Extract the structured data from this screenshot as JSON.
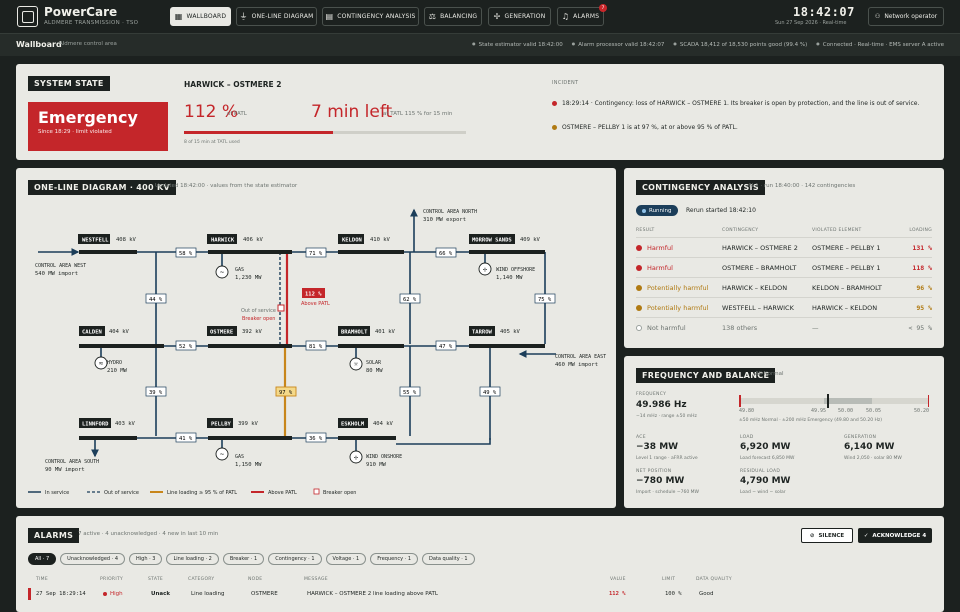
{
  "app": {
    "name": "PowerCare",
    "subtitle": "ALDMERE TRANSMISSION · TSO"
  },
  "nav": [
    {
      "label": "WALLBOARD",
      "icon": "▦",
      "active": true
    },
    {
      "label": "ONE-LINE DIAGRAM",
      "icon": "⏚"
    },
    {
      "label": "CONTINGENCY ANALYSIS",
      "icon": "▤"
    },
    {
      "label": "BALANCING",
      "icon": "⚖"
    },
    {
      "label": "GENERATION",
      "icon": "✢"
    },
    {
      "label": "ALARMS",
      "icon": "♫",
      "badge": "7"
    }
  ],
  "clock": {
    "time": "18:42:07",
    "date": "Sun 27 Sep 2026 · Real-time"
  },
  "operator": {
    "label": "Network operator"
  },
  "statusbar": {
    "title": "Wallboard",
    "subtitle": "Aldmere control area",
    "items": [
      "State estimator valid 18:42:00",
      "Alarm processor valid 18:42:07",
      "SCADA 18,412 of 18,530 points good (99.4 %)",
      "Connected · Real-time · EMS server A active"
    ]
  },
  "system_state": {
    "title": "SYSTEM STATE",
    "state": "Emergency",
    "since": "Since 18:29 · limit violated",
    "line": "HARWICK – OSTMERE 2",
    "loading": "112 %",
    "loading_unit": "of PATL",
    "time_left": "7 min left",
    "time_left_sub": "at TATL 115 % for 15 min",
    "tatl_used_fraction": 0.53,
    "tatl_caption": "8 of 15 min at TATL used",
    "incident_label": "INCIDENT",
    "incidents": [
      {
        "text": "18:29:14 · Contingency: loss of HARWICK – OSTMERE 1. Its breaker is open by protection, and the line is out of service.",
        "color": "#c4262a"
      },
      {
        "text": "OSTMERE – PELLBY 1 is at 97 %, at or above 95 % of PATL.",
        "color": "#b07a12"
      }
    ]
  },
  "oneline": {
    "title": "ONE-LINE DIAGRAM · 400 KV",
    "updated": "Updated 18:42:00 · values from the state estimator",
    "substations": {
      "westfell": {
        "name": "WESTFELL",
        "kv": "408 kV"
      },
      "harwick": {
        "name": "HARWICK",
        "kv": "406 kV"
      },
      "keldon": {
        "name": "KELDON",
        "kv": "410 kV"
      },
      "morrow": {
        "name": "MORROW SANDS",
        "kv": "409 kV"
      },
      "calden": {
        "name": "CALDEN",
        "kv": "404 kV"
      },
      "ostmere": {
        "name": "OSTMERE",
        "kv": "392 kV"
      },
      "bramholt": {
        "name": "BRAMHOLT",
        "kv": "401 kV"
      },
      "tarrow": {
        "name": "TARROW",
        "kv": "405 kV"
      },
      "linnford": {
        "name": "LINNFORD",
        "kv": "403 kV"
      },
      "pellby": {
        "name": "PELLBY",
        "kv": "399 kV"
      },
      "eskholm": {
        "name": "ESKHOLM",
        "kv": "404 kV"
      }
    },
    "flows": {
      "wh": "58 %",
      "hk": "71 %",
      "km": "66 %",
      "wc": "44 %",
      "mt": "75 %",
      "co": "52 %",
      "ob": "81 %",
      "bt": "47 %",
      "kb": "62 %",
      "cl": "39 %",
      "bes": "55 %",
      "te": "49 %",
      "lp": "41 %",
      "pe": "36 %",
      "op": "97 %"
    },
    "alarm_tag": "112 %",
    "alarm_tag_sub": "Above PATL",
    "out_of_service": "Out of service",
    "breaker_open": "Breaker open",
    "gens": {
      "harwick": {
        "type": "GAS",
        "mw": "1,230 MW"
      },
      "morrow": {
        "type": "WIND OFFSHORE",
        "mw": "1,140 MW"
      },
      "calden": {
        "type": "HYDRO",
        "mw": "210 MW"
      },
      "bramholt": {
        "type": "SOLAR",
        "mw": "80 MW"
      },
      "pellby": {
        "type": "GAS",
        "mw": "1,150 MW"
      },
      "eskholm": {
        "type": "WIND ONSHORE",
        "mw": "910 MW"
      }
    },
    "areas": {
      "west": {
        "name": "CONTROL AREA WEST",
        "flow": "540 MW import"
      },
      "north": {
        "name": "CONTROL AREA NORTH",
        "flow": "310 MW export"
      },
      "east": {
        "name": "CONTROL AREA EAST",
        "flow": "460 MW import"
      },
      "south": {
        "name": "CONTROL AREA SOUTH",
        "flow": "90 MW import"
      }
    },
    "legend": [
      "In service",
      "Out of service",
      "Line loading ≥ 95 % of PATL",
      "Above PATL",
      "Breaker open"
    ]
  },
  "contingency": {
    "title": "CONTINGENCY ANALYSIS",
    "meta": "N-1 · run 18:40:00 · 142 contingencies",
    "status": "Running",
    "rerun": "Rerun started 18:42:10",
    "headers": [
      "RESULT",
      "CONTINGENCY",
      "VIOLATED ELEMENT",
      "LOADING"
    ],
    "rows": [
      {
        "result": "Harmful",
        "cont": "HARWICK – OSTMERE 2",
        "elem": "OSTMERE – PELLBY 1",
        "load": "131 %",
        "color": "#c4262a"
      },
      {
        "result": "Harmful",
        "cont": "OSTMERE – BRAMHOLT",
        "elem": "OSTMERE – PELLBY 1",
        "load": "118 %",
        "color": "#c4262a"
      },
      {
        "result": "Potentially harmful",
        "cont": "HARWICK – KELDON",
        "elem": "KELDON – BRAMHOLT",
        "load": "96 %",
        "color": "#b07a12"
      },
      {
        "result": "Potentially harmful",
        "cont": "WESTFELL – HARWICK",
        "elem": "HARWICK – KELDON",
        "load": "95 %",
        "color": "#b07a12"
      },
      {
        "result": "Not harmful",
        "cont": "138 others",
        "elem": "—",
        "load": "< 95 %",
        "color": "#9aa19d"
      }
    ]
  },
  "frequency": {
    "title": "FREQUENCY AND BALANCE",
    "state": "All Normal",
    "freq_label": "FREQUENCY",
    "freq": "49.986 Hz",
    "freq_sub": "−14 mHz · range ±50 mHz",
    "scale": [
      "49.80",
      "49.95",
      "50.00",
      "50.05",
      "50.20"
    ],
    "scale_sub": "±50 mHz Normal · ±200 mHz Emergency (49.80 and 50.20 Hz)",
    "freq_fraction": 0.465,
    "cells": [
      {
        "label": "ACE",
        "value": "−38 MW",
        "sub": "Level 1 range · aFRR active"
      },
      {
        "label": "LOAD",
        "value": "6,920 MW",
        "sub": "Load forecast 6,850 MW"
      },
      {
        "label": "GENERATION",
        "value": "6,140 MW",
        "sub": "Wind 2,050 · solar 80 MW"
      },
      {
        "label": "NET POSITION",
        "value": "−780 MW",
        "sub": "Import · schedule −760 MW"
      },
      {
        "label": "RESIDUAL LOAD",
        "value": "4,790 MW",
        "sub": "Load − wind − solar"
      }
    ]
  },
  "alarms": {
    "title": "ALARMS",
    "meta": "7 active · 4 unacknowledged · 4 new in last 10 min",
    "silence": "SILENCE",
    "ack": "ACKNOWLEDGE 4",
    "chips": [
      "All · 7",
      "Unacknowledged · 4",
      "High · 3",
      "Line loading · 2",
      "Breaker · 1",
      "Contingency · 1",
      "Voltage · 1",
      "Frequency · 1",
      "Data quality · 1"
    ],
    "headers": [
      "TIME",
      "PRIORITY",
      "STATE",
      "CATEGORY",
      "NODE",
      "MESSAGE",
      "VALUE",
      "LIMIT",
      "DATA QUALITY"
    ],
    "rows": [
      {
        "time": "27 Sep 18:29:14",
        "priority": "High",
        "state": "Unack",
        "category": "Line loading",
        "node": "OSTMERE",
        "message": "HARWICK – OSTMERE 2 line loading above PATL",
        "value": "112 %",
        "limit": "100 %",
        "quality": "Good"
      }
    ]
  }
}
